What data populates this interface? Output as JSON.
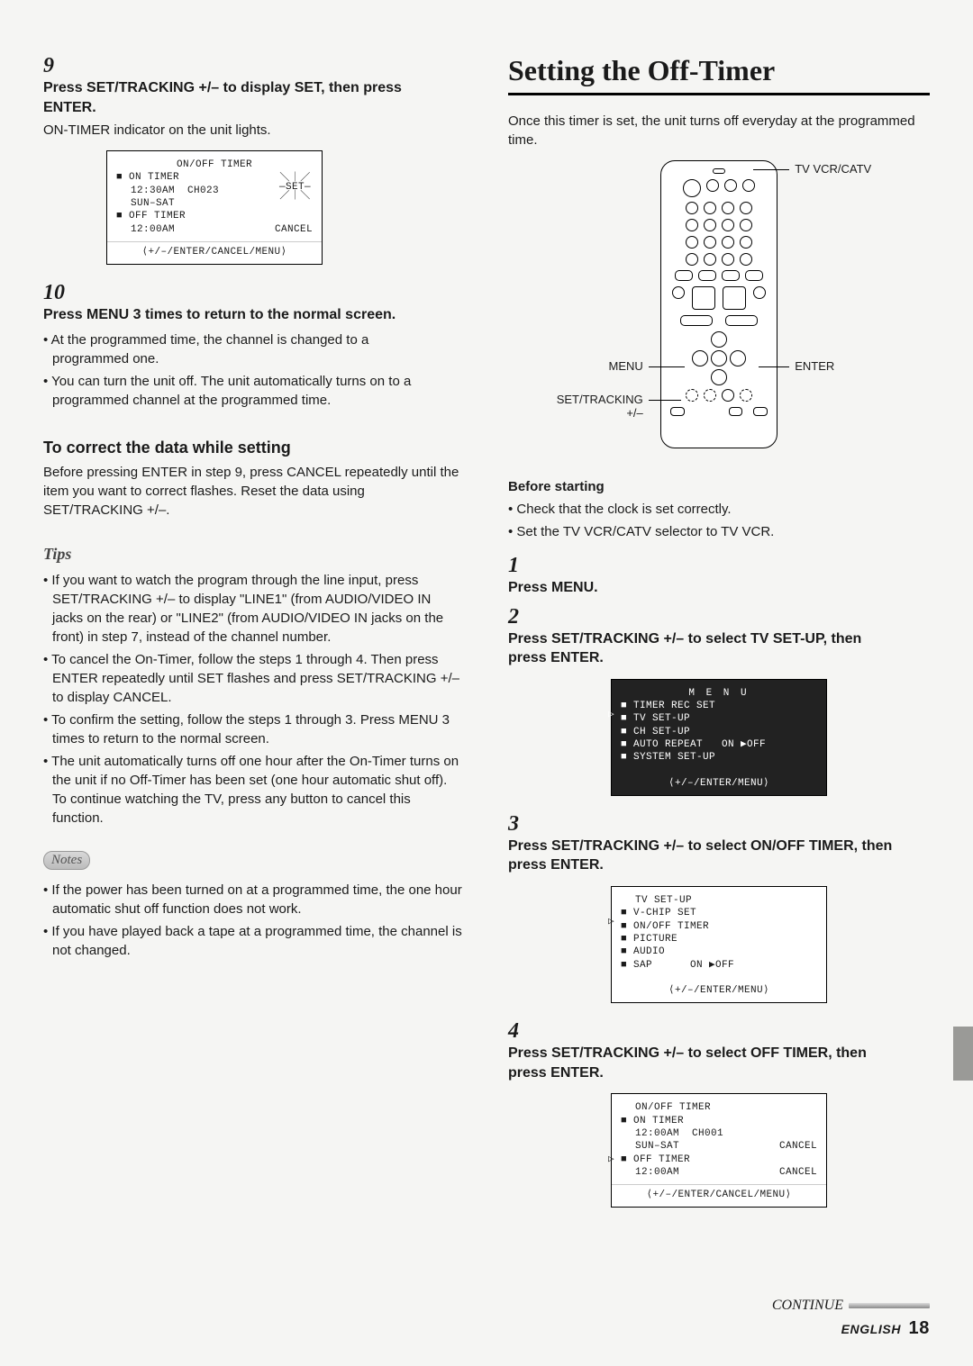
{
  "left": {
    "step9": {
      "num": "9",
      "head": "Press SET/TRACKING +/– to display SET, then press ENTER.",
      "para": "ON-TIMER indicator on the unit lights.",
      "osd": {
        "title": "ON/OFF TIMER",
        "on": "ON TIMER",
        "on_time": "12:30AM  CH023",
        "on_days": "SUN–SAT",
        "set_marks": "＼｜／\n—SET—\n／｜＼",
        "off": "OFF TIMER",
        "off_time": "12:00AM",
        "cancel": "CANCEL",
        "hint": "⟨+/–/ENTER/CANCEL/MENU⟩"
      }
    },
    "step10": {
      "num": "10",
      "head": "Press MENU 3 times to return to the normal screen.",
      "b1": "At the programmed time, the channel is changed to a programmed one.",
      "b2": "You can turn the unit off. The unit automatically turns on to a programmed channel at the programmed time."
    },
    "correct": {
      "title": "To correct the data while setting",
      "para": "Before pressing ENTER in step 9, press CANCEL repeatedly until the item you want to correct flashes. Reset the data using SET/TRACKING +/–."
    },
    "tips": {
      "label": "Tips",
      "t1": "If you want to watch the program through the line input, press SET/TRACKING +/– to display \"LINE1\" (from AUDIO/VIDEO IN jacks on the rear) or \"LINE2\" (from AUDIO/VIDEO IN jacks on the front) in step 7, instead of the channel number.",
      "t2": "To cancel the On-Timer, follow the steps 1 through 4. Then press ENTER repeatedly until SET flashes and press SET/TRACKING +/– to display CANCEL.",
      "t3": "To confirm the setting, follow the steps 1 through 3. Press MENU 3 times to return to the normal screen.",
      "t4": "The unit automatically turns off one hour after the On-Timer turns on the unit if no Off-Timer has been set (one hour automatic shut off). To continue watching the TV, press any button to cancel this function."
    },
    "notes": {
      "label": "Notes",
      "n1": "If the power has been turned on at a programmed time, the one hour automatic shut off function does not work.",
      "n2": "If you have played back a tape at a programmed time, the channel is not changed."
    }
  },
  "right": {
    "title": "Setting the Off-Timer",
    "intro": "Once this timer is set, the unit turns off everyday at the programmed time.",
    "labels": {
      "tv": "TV VCR/CATV",
      "menu": "MENU",
      "enter": "ENTER",
      "set": "SET/TRACKING +/–"
    },
    "before": {
      "head": "Before starting",
      "b1": "Check that the clock is set correctly.",
      "b2": "Set the TV VCR/CATV selector to TV VCR."
    },
    "s1": {
      "num": "1",
      "head": "Press MENU."
    },
    "s2": {
      "num": "2",
      "head": "Press SET/TRACKING +/– to select TV SET-UP, then press ENTER.",
      "osd": {
        "title": "M E N U",
        "l1": "TIMER REC SET",
        "l2": "TV SET-UP",
        "l3": "CH SET-UP",
        "l4": "AUTO REPEAT   ON ▶OFF",
        "l5": "SYSTEM SET-UP",
        "hint": "⟨+/–/ENTER/MENU⟩"
      }
    },
    "s3": {
      "num": "3",
      "head": "Press SET/TRACKING +/– to select ON/OFF TIMER, then press ENTER.",
      "osd": {
        "title": "TV SET-UP",
        "l1": "V-CHIP SET",
        "l2": "ON/OFF TIMER",
        "l3": "PICTURE",
        "l4": "AUDIO",
        "l5": "SAP      ON ▶OFF",
        "hint": "⟨+/–/ENTER/MENU⟩"
      }
    },
    "s4": {
      "num": "4",
      "head": "Press SET/TRACKING +/– to select OFF TIMER, then press ENTER.",
      "osd": {
        "title": "ON/OFF TIMER",
        "on": "ON TIMER",
        "on_time": "12:00AM  CH001",
        "on_days": "SUN–SAT",
        "on_cancel": "CANCEL",
        "off": "OFF TIMER",
        "off_time": "12:00AM",
        "off_cancel": "CANCEL",
        "hint": "⟨+/–/ENTER/CANCEL/MENU⟩"
      }
    }
  },
  "footer": {
    "continue": "CONTINUE",
    "lang": "ENGLISH",
    "page": "18"
  }
}
